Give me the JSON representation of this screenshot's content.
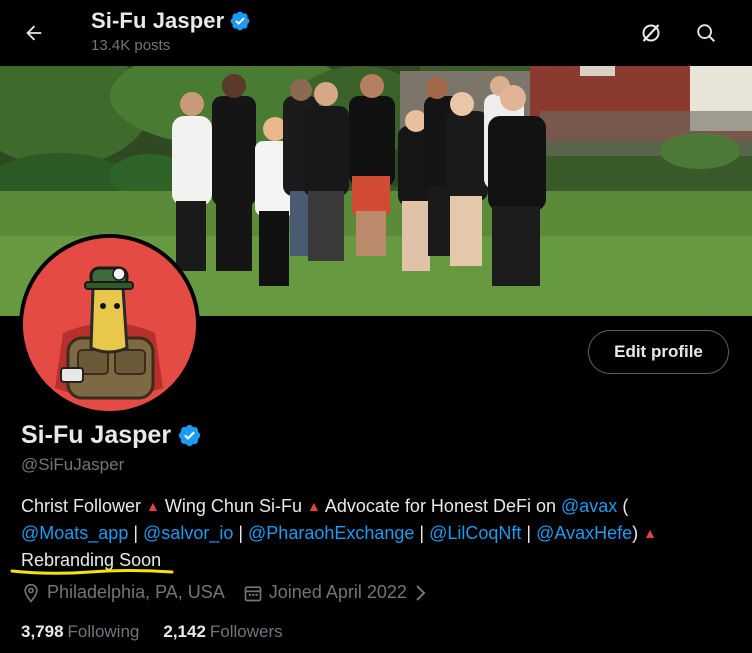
{
  "header": {
    "title": "Si-Fu Jasper",
    "posts": "13.4K posts"
  },
  "profile": {
    "name": "Si-Fu Jasper",
    "handle": "@SiFuJasper",
    "edit_label": "Edit profile"
  },
  "bio": {
    "t1": "Christ Follower",
    "t2": "Wing Chun Si-Fu",
    "t3": "Advocate for Honest DeFi on",
    "m_avax": "@avax",
    "paren_open": " (",
    "m_moats": "@Moats_app",
    "sep": " | ",
    "m_salvor": "@salvor_io",
    "m_pharaoh": "@PharaohExchange",
    "m_lilcoq": "@LilCoqNft",
    "m_avaxhefe": "@AvaxHefe",
    "paren_close": ")",
    "t4": "Rebranding Soon",
    "triangle": "▲"
  },
  "meta": {
    "location": "Philadelphia, PA, USA",
    "joined": "Joined April 2022"
  },
  "stats": {
    "following_count": "3,798",
    "following_label": "Following",
    "followers_count": "2,142",
    "followers_label": "Followers"
  },
  "colors": {
    "accent": "#1d9bf0",
    "avax_red": "#e84142",
    "highlight": "#f5e500"
  }
}
